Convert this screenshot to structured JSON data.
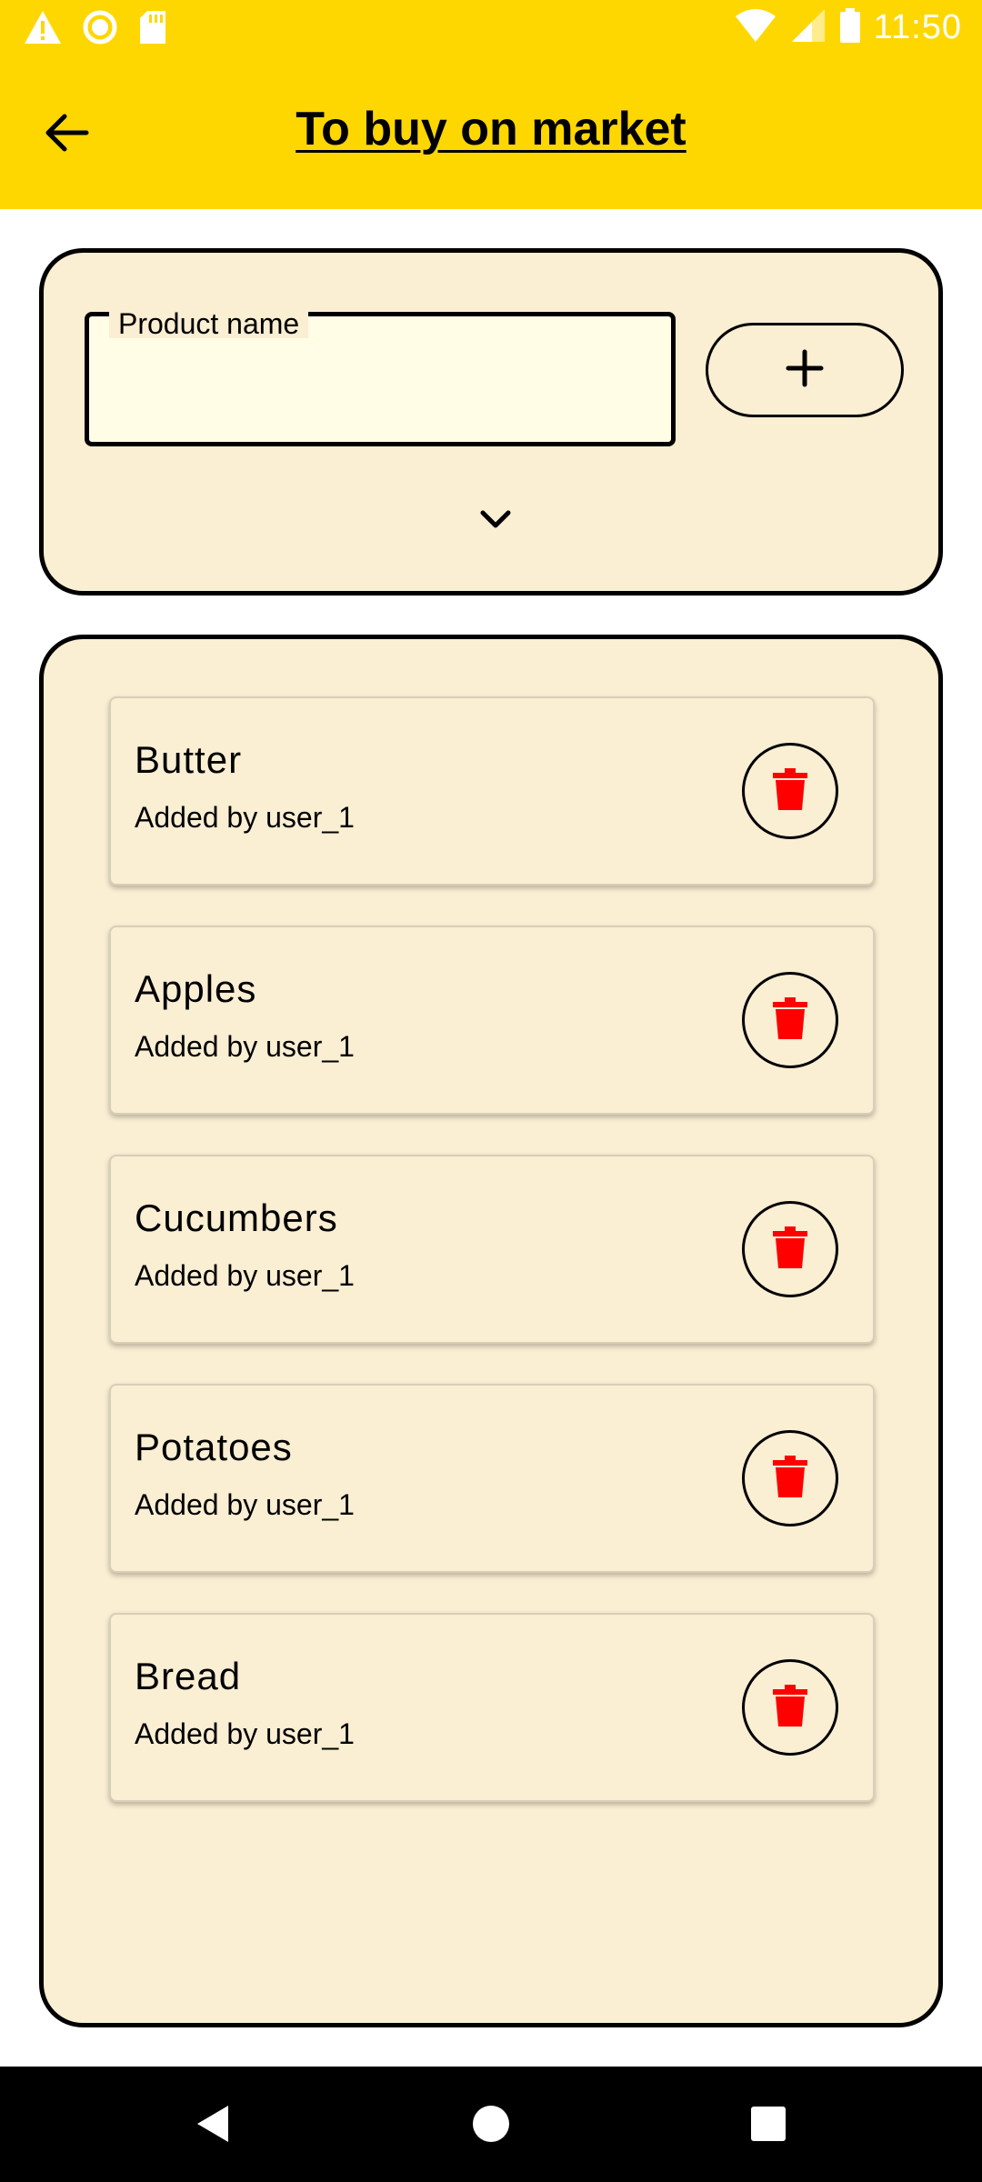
{
  "status_bar": {
    "time": "11:50",
    "icons": [
      "warning-icon",
      "circle-icon",
      "sd-card-icon",
      "wifi-icon",
      "signal-icon",
      "battery-icon"
    ]
  },
  "toolbar": {
    "title": "To buy on market",
    "back_icon": "arrow-left-icon",
    "background": "#FFD700"
  },
  "add_form": {
    "field_label": "Product name",
    "field_value": "",
    "add_icon": "plus-icon",
    "expand_icon": "chevron-down-icon"
  },
  "items": [
    {
      "name": "Butter",
      "added_by": "Added by user_1"
    },
    {
      "name": "Apples",
      "added_by": "Added by user_1"
    },
    {
      "name": "Cucumbers",
      "added_by": "Added by user_1"
    },
    {
      "name": "Potatoes",
      "added_by": "Added by user_1"
    },
    {
      "name": "Bread",
      "added_by": "Added by user_1"
    }
  ],
  "colors": {
    "card_bg": "#FAEED3",
    "delete_icon": "#FF0000"
  },
  "nav_bar": [
    "back-icon",
    "home-icon",
    "recents-icon"
  ]
}
